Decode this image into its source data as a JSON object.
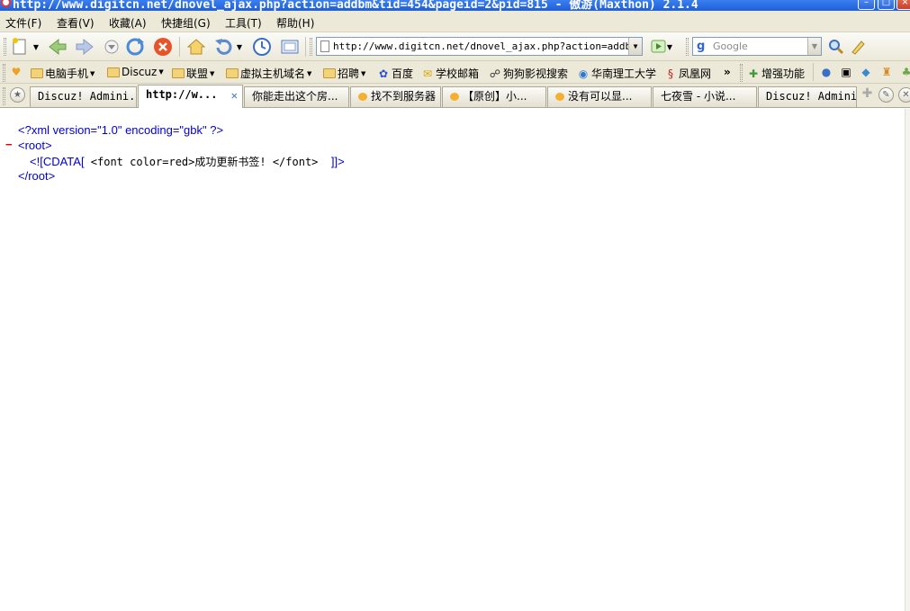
{
  "window": {
    "title": "http://www.digitcn.net/dnovel_ajax.php?action=addbm&tid=454&pageid=2&pid=815 - 傲游(Maxthon) 2.1.4"
  },
  "menu": {
    "items": [
      "文件(F)",
      "查看(V)",
      "收藏(A)",
      "快捷组(G)",
      "工具(T)",
      "帮助(H)"
    ]
  },
  "address": {
    "url": "http://www.digitcn.net/dnovel_ajax.php?action=addbm&ti"
  },
  "search": {
    "placeholder": "Google"
  },
  "favorites": {
    "items": [
      "电脑手机",
      "Discuz",
      "联盟",
      "虚拟主机域名",
      "招聘",
      "百度",
      "学校邮箱",
      "狗狗影视搜索",
      "华南理工大学",
      "凤凰网"
    ],
    "more": "»",
    "enhance": "增强功能"
  },
  "tabs": [
    {
      "label": "Discuz! Admini..."
    },
    {
      "label": "http://w..."
    },
    {
      "label": "你能走出这个房..."
    },
    {
      "label": "找不到服务器"
    },
    {
      "label": "【原创】小..."
    },
    {
      "label": "没有可以显..."
    },
    {
      "label": "七夜雪 - 小说..."
    },
    {
      "label": "Discuz! Admini..."
    }
  ],
  "xml": {
    "declaration": "<?xml version=\"1.0\" encoding=\"gbk\" ?>",
    "collapse": "−",
    "root_open": "<root>",
    "cdata_open": "<![CDATA[",
    "cdata_text": " <font color=red>成功更新书签! </font>  ",
    "cdata_close": "]]>",
    "root_close": "</root>"
  },
  "colors": {
    "tag_blue": "#0000cc",
    "collapse_red": "#dd0000",
    "chrome_bg": "#ece9d8",
    "titlebar_blue": "#1f5fd8"
  }
}
